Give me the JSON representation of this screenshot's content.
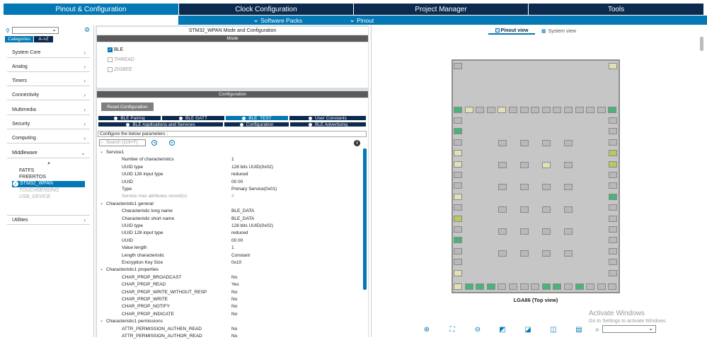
{
  "top_tabs": [
    {
      "label": "Pinout & Configuration",
      "active": true
    },
    {
      "label": "Clock Configuration",
      "active": false
    },
    {
      "label": "Project Manager",
      "active": false
    },
    {
      "label": "Tools",
      "active": false
    }
  ],
  "subbar": {
    "software_packs": "Software Packs",
    "pinout": "Pinout"
  },
  "left": {
    "search_placeholder": "",
    "tab_categories": "Categories",
    "tab_az": "A->Z",
    "categories": [
      "System Core",
      "Analog",
      "Timers",
      "Connectivity",
      "Multimedia",
      "Security",
      "Computing",
      "Middleware"
    ],
    "middleware_items": [
      "FATFS",
      "FREERTOS",
      "STM32_WPAN",
      "TOUCHSENSING",
      "USB_DEVICE"
    ],
    "utilities": "Utilities"
  },
  "middle": {
    "title": "STM32_WPAN Mode and Configuration",
    "mode_header": "Mode",
    "modes": [
      {
        "label": "BLE",
        "checked": true,
        "disabled": false
      },
      {
        "label": "THREAD",
        "checked": false,
        "disabled": true
      },
      {
        "label": "ZIGBEE",
        "checked": false,
        "disabled": true
      }
    ],
    "config_header": "Configuration",
    "reset_button": "Reset Configuration",
    "tabs_row1": [
      "BLE Pairing",
      "BLE GATT",
      "BLE_TEST",
      "User Constants"
    ],
    "tabs_row2": [
      "BLE Applications and Services",
      "Configuration",
      "BLE Advertising"
    ],
    "configure_text": "Configure the below parameters :",
    "search_placeholder": "Search (Crtl+F)",
    "params": [
      {
        "group": true,
        "k": "Service1",
        "v": ""
      },
      {
        "k": "Number of characteristics",
        "v": "1"
      },
      {
        "k": "UUID type",
        "v": "128 bits UUID(0x02)"
      },
      {
        "k": "UUID 128 input type",
        "v": "reduced"
      },
      {
        "k": "UUID",
        "v": "00 00"
      },
      {
        "k": "Type",
        "v": "Primary Service(0x01)"
      },
      {
        "k": "Service max attributes record(s)",
        "v": "3",
        "dim": true
      },
      {
        "group": true,
        "k": "Characteristic1 general",
        "v": ""
      },
      {
        "k": "Characteristic long name",
        "v": "BLE_DATA"
      },
      {
        "k": "Characteristic short name",
        "v": "BLE_DATA"
      },
      {
        "k": "UUID type",
        "v": "128 bits UUID(0x02)"
      },
      {
        "k": "UUID 128 input type",
        "v": "reduced"
      },
      {
        "k": "UUID",
        "v": "00 00"
      },
      {
        "k": "Value length",
        "v": "1"
      },
      {
        "k": "Length characteristic",
        "v": "Constant"
      },
      {
        "k": "Encryption Key Size",
        "v": "0x10"
      },
      {
        "group": true,
        "k": "Characteristic1 properties",
        "v": ""
      },
      {
        "k": "CHAR_PROP_BROADCAST",
        "v": "No"
      },
      {
        "k": "CHAR_PROP_READ",
        "v": "Yes"
      },
      {
        "k": "CHAR_PROP_WRITE_WITHOUT_RESP",
        "v": "No"
      },
      {
        "k": "CHAR_PROP_WRITE",
        "v": "No"
      },
      {
        "k": "CHAR_PROP_NOTIFY",
        "v": "No"
      },
      {
        "k": "CHAR_PROP_INDICATE",
        "v": "No"
      },
      {
        "group": true,
        "k": "Characteristic1 permissions",
        "v": ""
      },
      {
        "k": "ATTR_PERMISSION_AUTHEN_READ",
        "v": "No"
      },
      {
        "k": "ATTR_PERMISSION_AUTHOR_READ",
        "v": "No"
      }
    ]
  },
  "right": {
    "pinout_view": "Pinout view",
    "system_view": "System view",
    "package_label": "LGA86 (Top view)",
    "activate_title": "Activate Windows",
    "activate_sub": "Go to Settings to activate Windows."
  },
  "colors": {
    "accent": "#0378b4",
    "navy": "#0c2a4d",
    "pin_green": "#49b37a"
  }
}
